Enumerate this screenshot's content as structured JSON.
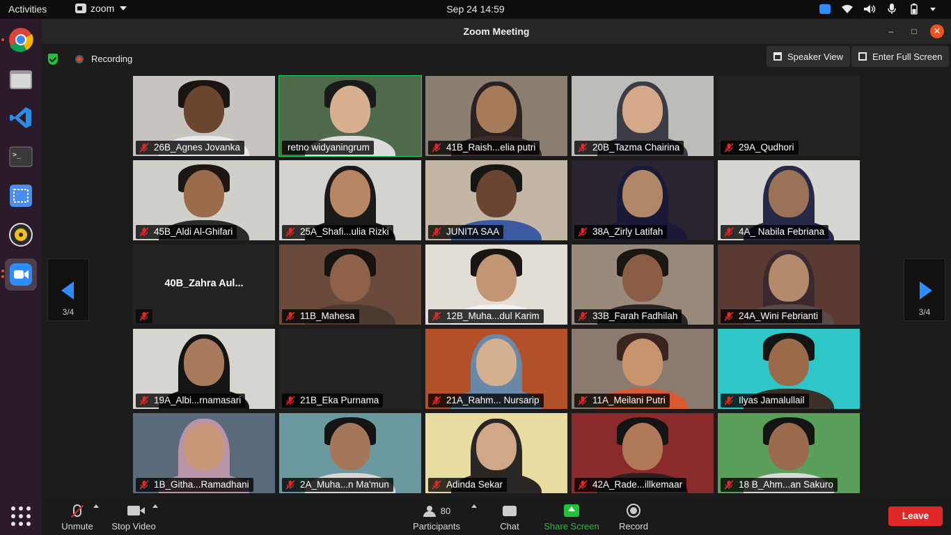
{
  "system_bar": {
    "activities": "Activities",
    "app_name": "zoom",
    "clock": "Sep 24  14:59"
  },
  "dock": [
    {
      "name": "chrome-icon",
      "color": "#4285f4"
    },
    {
      "name": "files-icon",
      "color": "#b9b9b9"
    },
    {
      "name": "vscode-icon",
      "color": "#2a8ee6"
    },
    {
      "name": "terminal-icon",
      "color": "#3a3a3a"
    },
    {
      "name": "screenshot-icon",
      "color": "#4a8ef0"
    },
    {
      "name": "rhythmbox-icon",
      "color": "#f0c020"
    },
    {
      "name": "zoom-icon",
      "color": "#2d8cff"
    }
  ],
  "window": {
    "title": "Zoom Meeting",
    "recording_label": "Recording",
    "speaker_view_label": "Speaker View",
    "full_screen_label": "Enter Full Screen"
  },
  "gallery": {
    "page_left": "3/4",
    "page_right": "3/4",
    "tiles": [
      {
        "name": "26B_Agnes Jovanka",
        "muted": true,
        "bg": "#c8c5c0",
        "skin": "#6a4630",
        "hair": "#1b1410",
        "shirt": "#e9e9e9",
        "hijab": false
      },
      {
        "name": "retno widyaningrum",
        "muted": false,
        "active": true,
        "bg": "#4f6a4a",
        "skin": "#d8b090",
        "hair": "#1a1a1a",
        "shirt": "#dcdcdc",
        "hijab": false
      },
      {
        "name": "41B_Raish...elia putri",
        "muted": true,
        "bg": "#8a7e70",
        "skin": "#a67b5a",
        "hair": "#2a2220",
        "shirt": "#3a2c2a",
        "hijab": true
      },
      {
        "name": "20B_Tazma Chairina",
        "muted": true,
        "bg": "#bdbcb8",
        "skin": "#d3a98a",
        "hair": "#3b3c45",
        "shirt": "#3b3c45",
        "hijab": true
      },
      {
        "name": "29A_Qudhori",
        "muted": true,
        "empty": true
      },
      {
        "name": "45B_Aldi Al-Ghifari",
        "muted": true,
        "bg": "#d0cfca",
        "skin": "#9a6c4c",
        "hair": "#1e1612",
        "shirt": "#2b2b2b",
        "hijab": false
      },
      {
        "name": "25A_Shafi...ulia Rizki",
        "muted": true,
        "bg": "#d5d3ce",
        "skin": "#b88664",
        "hair": "#1a1a1a",
        "shirt": "#1a1a1a",
        "hijab": true
      },
      {
        "name": "JUNITA SAA",
        "muted": true,
        "bg": "#c4b6a4",
        "skin": "#6a4632",
        "hair": "#151515",
        "shirt": "#3c5aa0",
        "hijab": false
      },
      {
        "name": "38A_Zirly Latifah",
        "muted": true,
        "bg": "#2a2430",
        "skin": "#b08868",
        "hair": "#1a1a38",
        "shirt": "#1a1a38",
        "hijab": true
      },
      {
        "name": "4A_ Nabila Febriana",
        "muted": true,
        "bg": "#d8d6d2",
        "skin": "#9c7256",
        "hair": "#262a48",
        "shirt": "#262a48",
        "hijab": true
      },
      {
        "name": "40B_Zahra Aul...",
        "muted": true,
        "nameonly": true
      },
      {
        "name": "11B_Mahesa",
        "muted": true,
        "bg": "#6a4a3a",
        "skin": "#8e6248",
        "hair": "#151210",
        "shirt": "#4a3a30",
        "hijab": false
      },
      {
        "name": "12B_Muha...dul Karim",
        "muted": true,
        "bg": "#e2ddd5",
        "skin": "#c29674",
        "hair": "#1a1512",
        "shirt": "#f0f0f0",
        "hijab": false
      },
      {
        "name": "33B_Farah Fadhilah",
        "muted": true,
        "bg": "#9a8a7c",
        "skin": "#8a5e44",
        "hair": "#1a1614",
        "shirt": "#2a2424",
        "hijab": false
      },
      {
        "name": "24A_Wini Febrianti",
        "muted": true,
        "bg": "#5a3a32",
        "skin": "#b38a6c",
        "hair": "#3a2a30",
        "shirt": "#5a4a48",
        "hijab": true
      },
      {
        "name": "19A_Albi...rnamasari",
        "muted": true,
        "bg": "#d6d5d0",
        "skin": "#a67a5a",
        "hair": "#141414",
        "shirt": "#141414",
        "hijab": true
      },
      {
        "name": "21B_Eka Purnama",
        "muted": true,
        "empty": true
      },
      {
        "name": "21A_Rahm... Nursarip",
        "muted": true,
        "bg": "#b2502a",
        "skin": "#d5b090",
        "hair": "#6a88a8",
        "shirt": "#6a88a8",
        "hijab": true
      },
      {
        "name": "11A_Meilani Putri",
        "muted": true,
        "bg": "#8a7a70",
        "skin": "#c8946e",
        "hair": "#3a2420",
        "shirt": "#d85a30",
        "hijab": false
      },
      {
        "name": "Ilyas Jamalullail",
        "muted": true,
        "bg": "#2fc6c8",
        "skin": "#9a6a4a",
        "hair": "#141414",
        "shirt": "#3a3028",
        "hijab": false
      },
      {
        "name": "1B_Githa...Ramadhani",
        "muted": true,
        "bg": "#5a6a7a",
        "skin": "#c99878",
        "hair": "#b894a8",
        "shirt": "#b894a8",
        "hijab": true
      },
      {
        "name": "2A_Muha...n Ma'mun",
        "muted": true,
        "bg": "#6a9aa0",
        "skin": "#a4765a",
        "hair": "#141414",
        "shirt": "#d8d6d2",
        "hijab": false
      },
      {
        "name": "Adinda Sekar",
        "muted": true,
        "bg": "#e8dca0",
        "skin": "#d0a888",
        "hair": "#2a2624",
        "shirt": "#2a2624",
        "hijab": true
      },
      {
        "name": "42A_Rade...illkemaar",
        "muted": true,
        "bg": "#8a2a2a",
        "skin": "#b07a5a",
        "hair": "#141414",
        "shirt": "#2a2222",
        "hijab": false
      },
      {
        "name": "18 B_Ahm...an Sakuro",
        "muted": true,
        "bg": "#5aa05a",
        "skin": "#9a6a4c",
        "hair": "#141414",
        "shirt": "#d8d8d8",
        "hijab": false
      }
    ]
  },
  "toolbar": {
    "unmute": "Unmute",
    "stop_video": "Stop Video",
    "participants": "Participants",
    "participants_count": "80",
    "chat": "Chat",
    "share_screen": "Share Screen",
    "record": "Record",
    "leave": "Leave"
  }
}
